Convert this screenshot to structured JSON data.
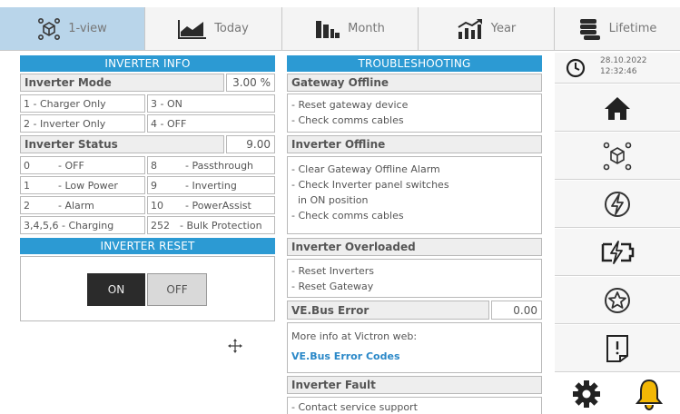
{
  "tabs": [
    {
      "label": "1-view",
      "icon": "cube-network-icon",
      "active": true
    },
    {
      "label": "Today",
      "icon": "area-chart-icon",
      "active": false
    },
    {
      "label": "Month",
      "icon": "bar-chart-icon",
      "active": false
    },
    {
      "label": "Year",
      "icon": "trend-chart-icon",
      "active": false
    },
    {
      "label": "Lifetime",
      "icon": "coins-stack-icon",
      "active": false
    }
  ],
  "inverter_info": {
    "title": "INVERTER INFO",
    "mode_label": "Inverter Mode",
    "mode_value": "3.00 %",
    "modes": [
      "1 - Charger Only",
      "3 - ON",
      "2 - Inverter Only",
      "4 - OFF"
    ],
    "status_label": "Inverter Status",
    "status_value": "9.00",
    "statuses": [
      {
        "code": "0",
        "text": "- OFF"
      },
      {
        "code": "8",
        "text": "- Passthrough"
      },
      {
        "code": "1",
        "text": "- Low Power"
      },
      {
        "code": "9",
        "text": "- Inverting"
      },
      {
        "code": "2",
        "text": "- Alarm"
      },
      {
        "code": "10",
        "text": "- PowerAssist"
      },
      {
        "code": "3,4,5,6",
        "text": "- Charging"
      },
      {
        "code": "252",
        "text": "- Bulk Protection"
      }
    ]
  },
  "inverter_reset": {
    "title": "INVERTER RESET",
    "on_label": "ON",
    "off_label": "OFF",
    "state": "ON"
  },
  "troubleshooting": {
    "title": "TROUBLESHOOTING",
    "gateway_offline": {
      "heading": "Gateway Offline",
      "lines": [
        "- Reset gateway device",
        "- Check comms cables"
      ]
    },
    "inverter_offline": {
      "heading": "Inverter Offline",
      "lines": [
        "- Clear Gateway Offline Alarm",
        "- Check Inverter panel switches",
        "  in ON position",
        "- Check comms cables"
      ]
    },
    "inverter_overloaded": {
      "heading": "Inverter Overloaded",
      "lines": [
        "- Reset Inverters",
        "- Reset Gateway"
      ]
    },
    "vebus_error": {
      "heading": "VE.Bus Error",
      "value": "0.00",
      "info": "More info at Victron web:",
      "link": "VE.Bus Error Codes"
    },
    "inverter_fault": {
      "heading": "Inverter Fault",
      "lines": [
        "- Contact service support"
      ]
    }
  },
  "sidebar": {
    "date": "28.10.2022",
    "time": "12:32:46",
    "items": [
      "home-icon",
      "system-overview-icon",
      "energy-icon",
      "battery-charge-icon",
      "favorite-star-icon",
      "report-icon"
    ],
    "settings_icon": "gear-icon",
    "alarm_icon": "bell-icon",
    "alarm_color": "#f2b705"
  },
  "colors": {
    "accent": "#2c9ad3",
    "active_tab": "#b9d5ea"
  }
}
